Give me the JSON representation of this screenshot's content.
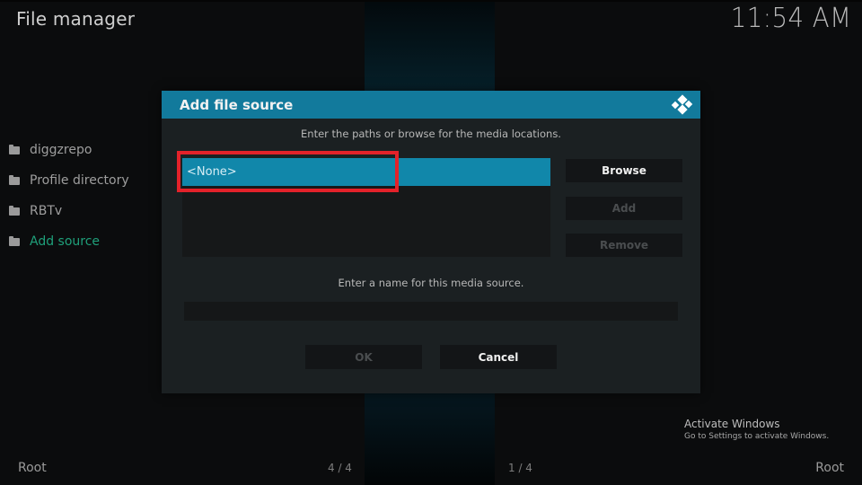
{
  "app": {
    "title": "File manager",
    "clock": "11:54 AM"
  },
  "sidebar": {
    "items": [
      {
        "label": "diggzrepo",
        "icon": "folder-icon"
      },
      {
        "label": "Profile directory",
        "icon": "folder-icon"
      },
      {
        "label": "RBTv",
        "icon": "folder-icon"
      },
      {
        "label": "Add source",
        "icon": "folder-icon",
        "accent": true
      }
    ]
  },
  "dialog": {
    "title": "Add file source",
    "logo": "kodi-logo-icon",
    "paths_instruction": "Enter the paths or browse for the media locations.",
    "paths": [
      {
        "value": "<None>",
        "selected": true
      }
    ],
    "buttons": {
      "browse": "Browse",
      "add": "Add",
      "remove": "Remove",
      "ok": "OK",
      "cancel": "Cancel"
    },
    "name_instruction": "Enter a name for this media source.",
    "name_value": "",
    "name_placeholder": ""
  },
  "footer": {
    "left_label": "Root",
    "left_count": "4 / 4",
    "right_count": "1 / 4",
    "right_label": "Root"
  },
  "watermark": {
    "line1": "Activate Windows",
    "line2": "Go to Settings to activate Windows."
  },
  "colors": {
    "accent_header": "#127a9c",
    "selected_row": "#1187aa",
    "accent_text": "#1fa07a",
    "highlight_box": "#e3222a"
  }
}
